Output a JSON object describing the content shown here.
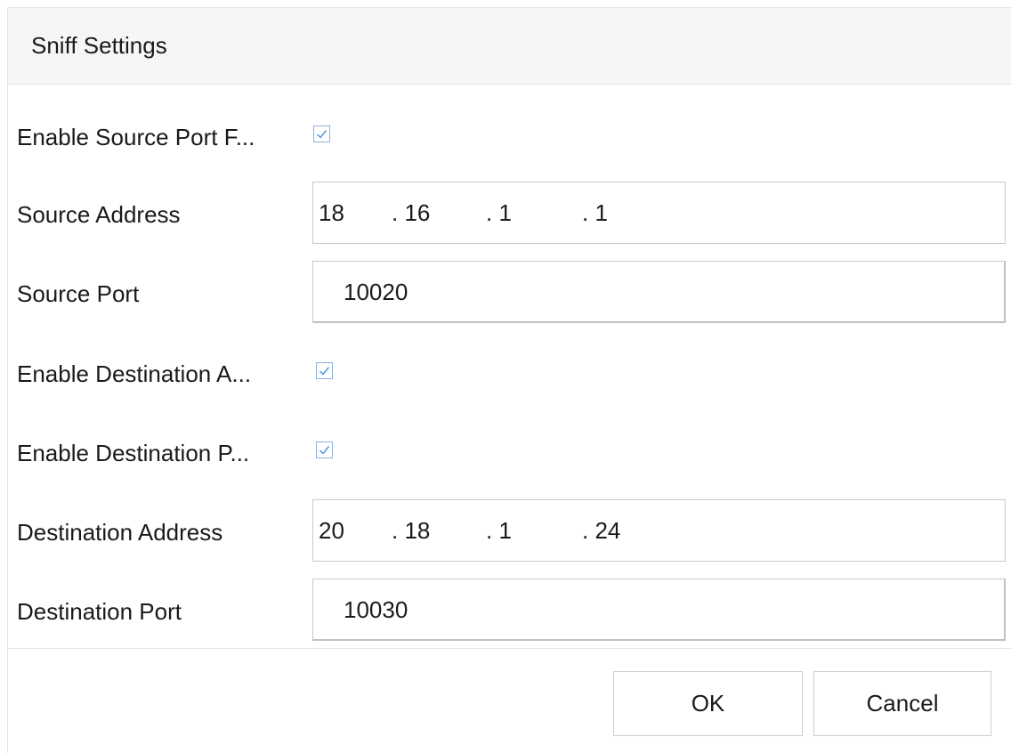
{
  "dialog": {
    "title": "Sniff Settings"
  },
  "form": {
    "enable_source_port": {
      "label": "Enable Source Port F...",
      "checked": true
    },
    "source_address": {
      "label": "Source Address",
      "octets": [
        "18",
        ". 16",
        ". 1",
        ". 1"
      ]
    },
    "source_port": {
      "label": "Source Port",
      "value": "10020"
    },
    "enable_destination_address": {
      "label": "Enable Destination A...",
      "checked": true
    },
    "enable_destination_port": {
      "label": "Enable Destination P...",
      "checked": true
    },
    "destination_address": {
      "label": "Destination Address",
      "octets": [
        "20",
        ". 18",
        ". 1",
        ". 24"
      ]
    },
    "destination_port": {
      "label": "Destination Port",
      "value": "10030"
    }
  },
  "buttons": {
    "ok_label": "OK",
    "cancel_label": "Cancel"
  },
  "colors": {
    "title_bar_bg": "#f6f6f6",
    "checkbox_border": "#8fb0d9",
    "checkmark": "#4a90e2",
    "text": "#1a1a1a"
  }
}
